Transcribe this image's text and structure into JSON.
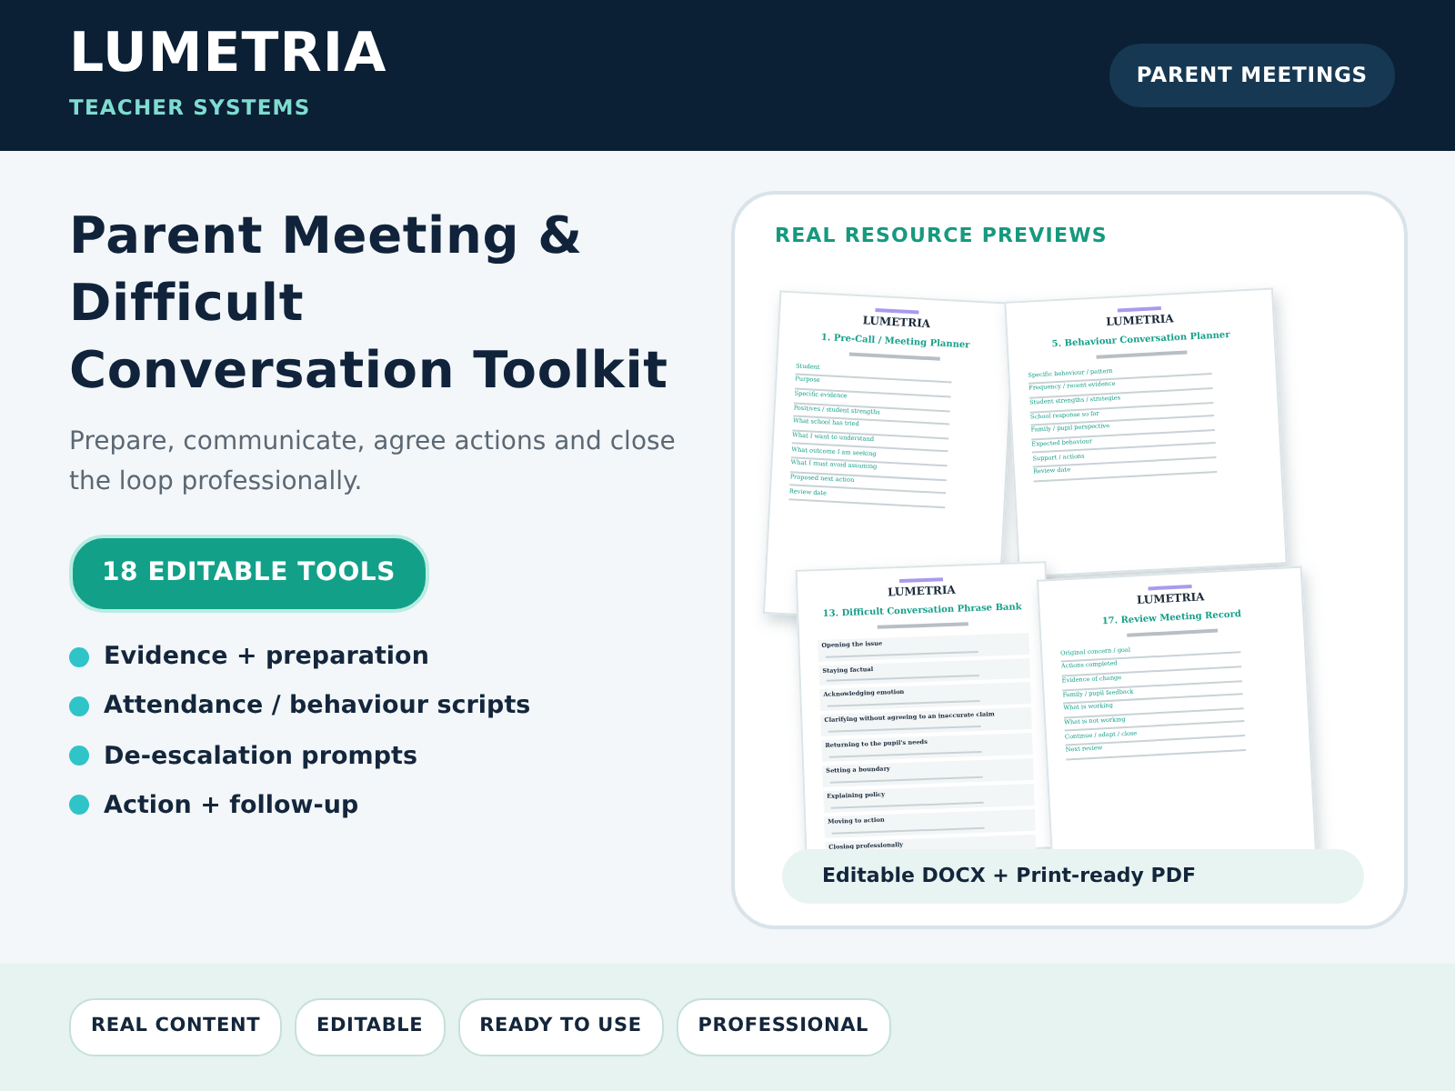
{
  "header": {
    "brand": "LUMETRIA",
    "tagline": "TEACHER SYSTEMS",
    "badge": "PARENT MEETINGS"
  },
  "hero": {
    "title": "Parent Meeting & Difficult Conversation Toolkit",
    "subtitle": "Prepare, communicate, agree actions and close the loop professionally.",
    "pill": "18 EDITABLE TOOLS",
    "bullets": [
      "Evidence + preparation",
      "Attendance / behaviour scripts",
      "De-escalation prompts",
      "Action + follow-up"
    ]
  },
  "preview": {
    "label": "REAL RESOURCE PREVIEWS",
    "documents": [
      {
        "kind": "form",
        "brand": "LUMETRIA",
        "title": "1. Pre-Call / Meeting Planner",
        "fields": [
          "Student",
          "Purpose",
          "Specific evidence",
          "Positives / student strengths",
          "What school has tried",
          "What I want to understand",
          "What outcome I am seeking",
          "What I must avoid assuming",
          "Proposed next action",
          "Review date"
        ]
      },
      {
        "kind": "form",
        "brand": "LUMETRIA",
        "title": "5. Behaviour Conversation Planner",
        "fields": [
          "Specific behaviour / pattern",
          "Frequency / recent evidence",
          "Student strengths / strategies",
          "School response so far",
          "Family / pupil perspective",
          "Expected behaviour",
          "Support / actions",
          "Review date"
        ]
      },
      {
        "kind": "phrase_bank",
        "brand": "LUMETRIA",
        "title": "13. Difficult Conversation Phrase Bank",
        "fields": [
          "Opening the issue",
          "Staying factual",
          "Acknowledging emotion",
          "Clarifying without agreeing to an inaccurate claim",
          "Returning to the pupil's needs",
          "Setting a boundary",
          "Explaining policy",
          "Moving to action",
          "Closing professionally"
        ]
      },
      {
        "kind": "form",
        "brand": "LUMETRIA",
        "title": "17. Review Meeting Record",
        "fields": [
          "Original concern / goal",
          "Actions completed",
          "Evidence of change",
          "Family / pupil feedback",
          "What is working",
          "What is not working",
          "Continue / adapt / close",
          "Next review"
        ]
      }
    ],
    "formats": "Editable DOCX  +  Print-ready PDF"
  },
  "footer_tags": [
    "REAL CONTENT",
    "EDITABLE",
    "READY TO USE",
    "PROFESSIONAL"
  ]
}
